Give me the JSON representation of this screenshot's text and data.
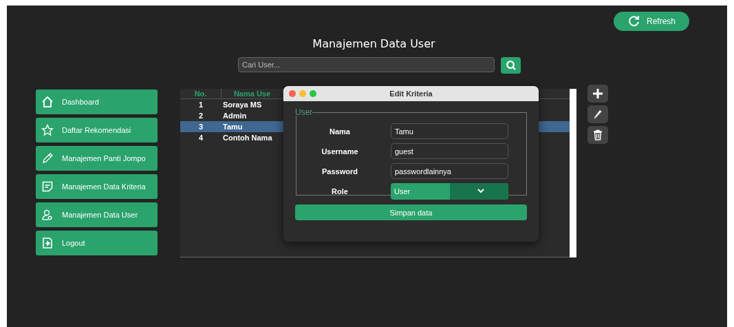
{
  "refresh_button": {
    "label": "Refresh"
  },
  "title": "Manajemen Data User",
  "search": {
    "placeholder": "Cari User..."
  },
  "sidebar": {
    "items": [
      {
        "label": "Dashboard"
      },
      {
        "label": "Daftar Rekomendasi"
      },
      {
        "label": "Manajemen Panti Jompo"
      },
      {
        "label": "Manajemen Data Kriteria"
      },
      {
        "label": "Manajemen Data User"
      },
      {
        "label": "Logout"
      }
    ]
  },
  "table": {
    "columns": [
      "No.",
      "Nama Use"
    ],
    "rows": [
      {
        "cells": [
          "1",
          "Soraya MS"
        ],
        "selected": false
      },
      {
        "cells": [
          "2",
          "Admin"
        ],
        "selected": false
      },
      {
        "cells": [
          "3",
          "Tamu"
        ],
        "selected": true
      },
      {
        "cells": [
          "4",
          "Contoh Nama"
        ],
        "selected": false
      }
    ]
  },
  "dialog": {
    "title": "Edit Kriteria",
    "group_label": "User",
    "fields": [
      {
        "label": "Nama",
        "value": "Tamu",
        "kind": "text"
      },
      {
        "label": "Username",
        "value": "guest",
        "kind": "text"
      },
      {
        "label": "Password",
        "value": "passwordlainnya",
        "kind": "text"
      },
      {
        "label": "Role",
        "value": "User",
        "kind": "select"
      }
    ],
    "submit": "Simpan data"
  }
}
